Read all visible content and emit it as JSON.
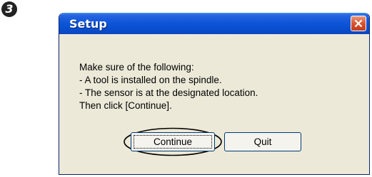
{
  "step": {
    "number": "3"
  },
  "window": {
    "title": "Setup"
  },
  "message": {
    "lines": [
      "Make sure of the following:",
      "- A tool is installed on the spindle.",
      "- The sensor is at the designated location.",
      "Then click [Continue]."
    ]
  },
  "buttons": {
    "continue_label": "Continue",
    "quit_label": "Quit"
  },
  "colors": {
    "titlebar": "#0850d0",
    "close": "#d9532f",
    "dialog_bg": "#ece9d8"
  }
}
